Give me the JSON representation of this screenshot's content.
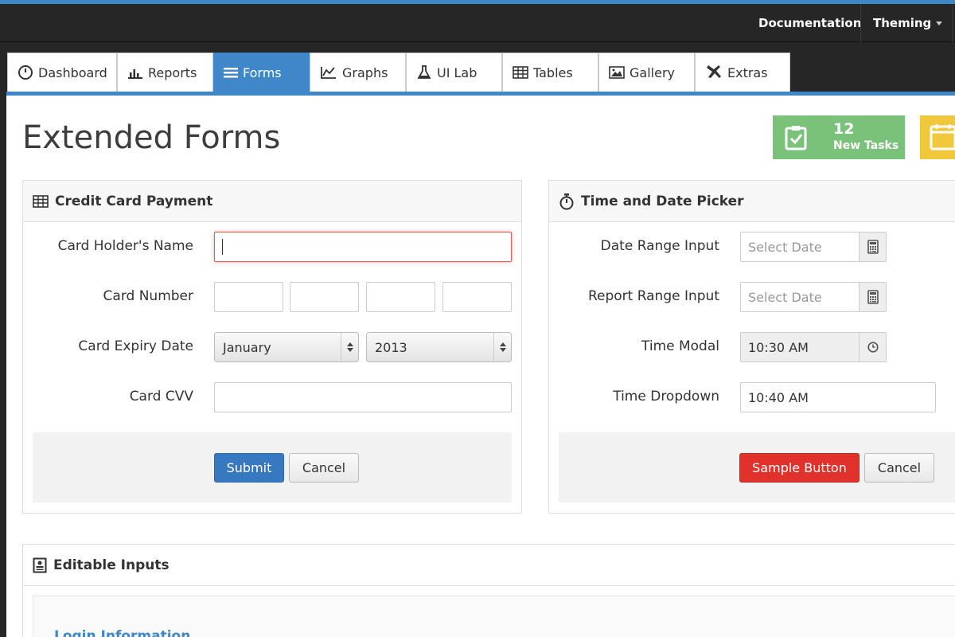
{
  "topbar": {
    "links": [
      "Documentation",
      "Theming"
    ]
  },
  "tabs": [
    {
      "label": "Dashboard",
      "icon": "dashboard-icon"
    },
    {
      "label": "Reports",
      "icon": "bar-chart-icon"
    },
    {
      "label": "Forms",
      "icon": "list-icon",
      "active": true
    },
    {
      "label": "Graphs",
      "icon": "line-chart-icon"
    },
    {
      "label": "UI Lab",
      "icon": "flask-icon"
    },
    {
      "label": "Tables",
      "icon": "table-icon"
    },
    {
      "label": "Gallery",
      "icon": "picture-icon"
    },
    {
      "label": "Extras",
      "icon": "plane-icon"
    }
  ],
  "page": {
    "title": "Extended Forms",
    "stat": {
      "number": "12",
      "label": "New Tasks",
      "color": "#7ac27a"
    }
  },
  "credit_card": {
    "title": "Credit Card Payment",
    "labels": {
      "holder": "Card Holder's Name",
      "number": "Card Number",
      "expiry": "Card Expiry Date",
      "cvv": "Card CVV"
    },
    "month": "January",
    "year": "2013",
    "submit": "Submit",
    "cancel": "Cancel"
  },
  "picker": {
    "title": "Time and Date Picker",
    "labels": {
      "date_range": "Date Range Input",
      "report_range": "Report Range Input",
      "time_modal": "Time Modal",
      "time_dropdown": "Time Dropdown"
    },
    "date_placeholder": "Select Date",
    "report_placeholder": "Select Date",
    "time_modal_value": "10:30 AM",
    "time_dropdown_value": "10:40 AM",
    "sample_button": "Sample Button",
    "cancel": "Cancel"
  },
  "editable": {
    "title": "Editable Inputs",
    "section_link": "Login Information"
  },
  "colors": {
    "accent": "#3f87c8",
    "danger": "#e0312b",
    "success": "#7ac27a",
    "warning": "#f1c83c"
  }
}
